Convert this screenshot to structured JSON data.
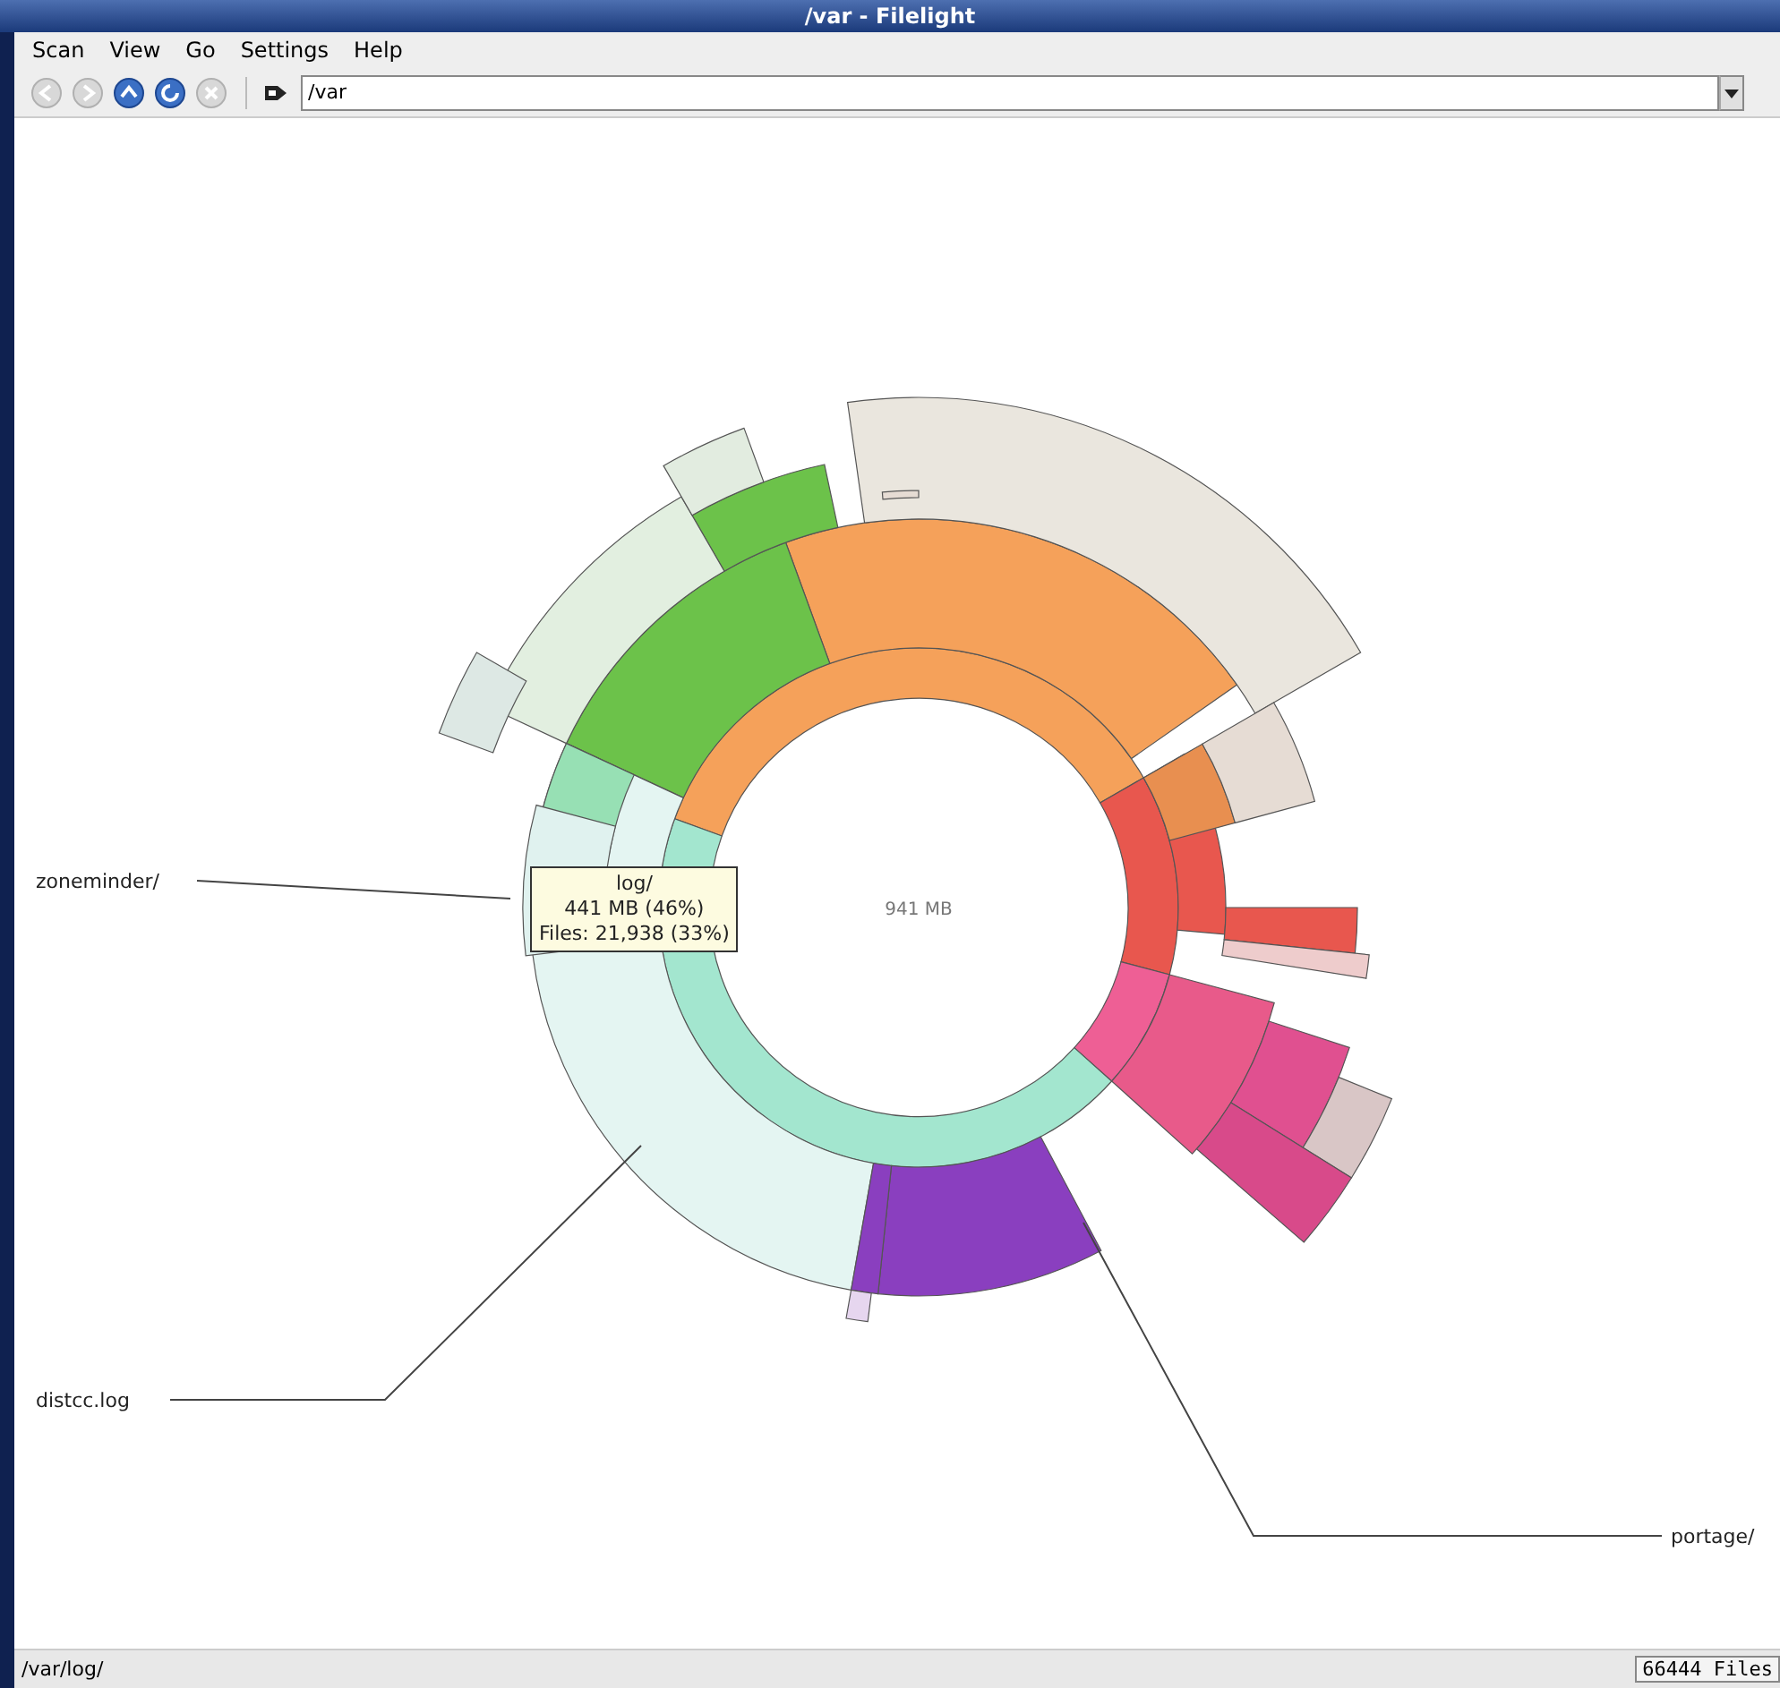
{
  "window": {
    "title": "/var - Filelight"
  },
  "menu": [
    "Scan",
    "View",
    "Go",
    "Settings",
    "Help"
  ],
  "toolbar": {
    "buttons": [
      {
        "kind": "back",
        "disabled": true
      },
      {
        "kind": "forward",
        "disabled": true
      },
      {
        "kind": "up",
        "disabled": false
      },
      {
        "kind": "refresh",
        "disabled": false
      },
      {
        "kind": "stop",
        "disabled": true
      }
    ],
    "location": {
      "value": "/var"
    }
  },
  "map": {
    "center_label": "941 MB",
    "labels": [
      "zoneminder/",
      "distcc.log",
      "portage/"
    ],
    "tooltip": [
      "log/",
      "441 MB (46%)",
      "Files: 21,938 (33%)"
    ]
  },
  "status_bar": {
    "path": "/var/log/",
    "files": "66444 Files"
  }
}
